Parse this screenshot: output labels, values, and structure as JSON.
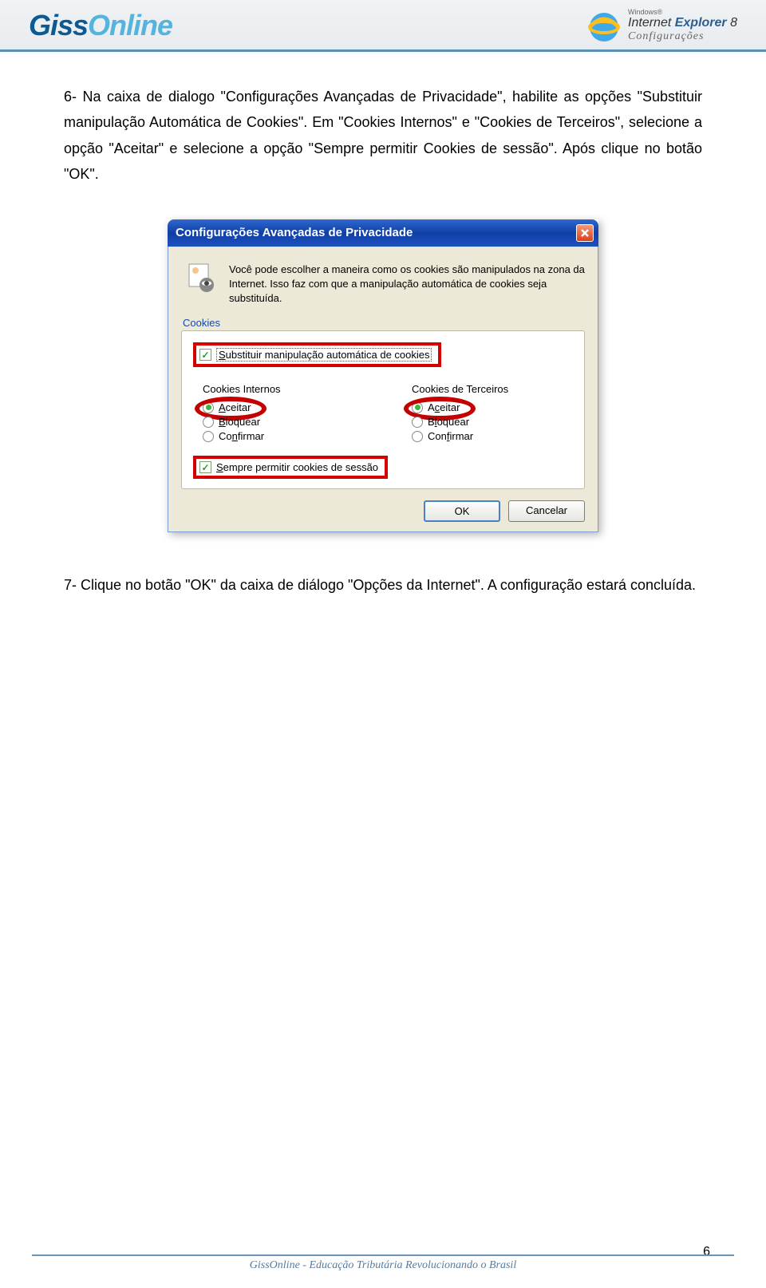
{
  "header": {
    "logo_part1": "Giss",
    "logo_part2": "Online",
    "ie_small": "Windows®",
    "ie_main_a": "Internet ",
    "ie_main_b": "Explorer",
    "ie_main_c": " 8",
    "ie_conf": "Configurações"
  },
  "para1": "6- Na caixa de dialogo \"Configurações Avançadas de Privacidade\", habilite as opções \"Substituir manipulação Automática de Cookies\". Em \"Cookies Internos\" e \"Cookies de Terceiros\", selecione a opção \"Aceitar\" e selecione a opção \"Sempre permitir Cookies de sessão\". Após clique no botão \"OK\".",
  "dialog": {
    "title": "Configurações Avançadas de Privacidade",
    "intro": "Você pode escolher a maneira como os cookies são manipulados na zona da Internet. Isso faz com que a manipulação automática de cookies seja substituída.",
    "group": "Cookies",
    "chk_override_pre": "S",
    "chk_override_rest": "ubstituir manipulação automática de cookies",
    "col1_title": "Cookies Internos",
    "col2_title": "Cookies de Terceiros",
    "radio_accept_u": "A",
    "radio_accept_rest": "ceitar",
    "radio_block_u": "B",
    "radio_block_rest": "loquear",
    "radio_confirm_u1": "Co",
    "radio_confirm_n": "n",
    "radio_confirm_rest": "firmar",
    "radio_accept2_u": "c",
    "radio_accept2_pre": "A",
    "radio_accept2_rest": "eitar",
    "radio_block2_u": "l",
    "radio_block2_pre": "B",
    "radio_block2_rest": "oquear",
    "radio_confirm2_u": "f",
    "radio_confirm2_pre": "Con",
    "radio_confirm2_rest": "irmar",
    "chk_session_u": "S",
    "chk_session_rest": "empre permitir cookies de sessão",
    "ok": "OK",
    "cancel": "Cancelar"
  },
  "para2": "7- Clique no botão \"OK\" da caixa de diálogo \"Opções da Internet\". A configuração estará concluída.",
  "footer": "GissOnline - Educação Tributária Revolucionando o Brasil",
  "page_number": "6"
}
